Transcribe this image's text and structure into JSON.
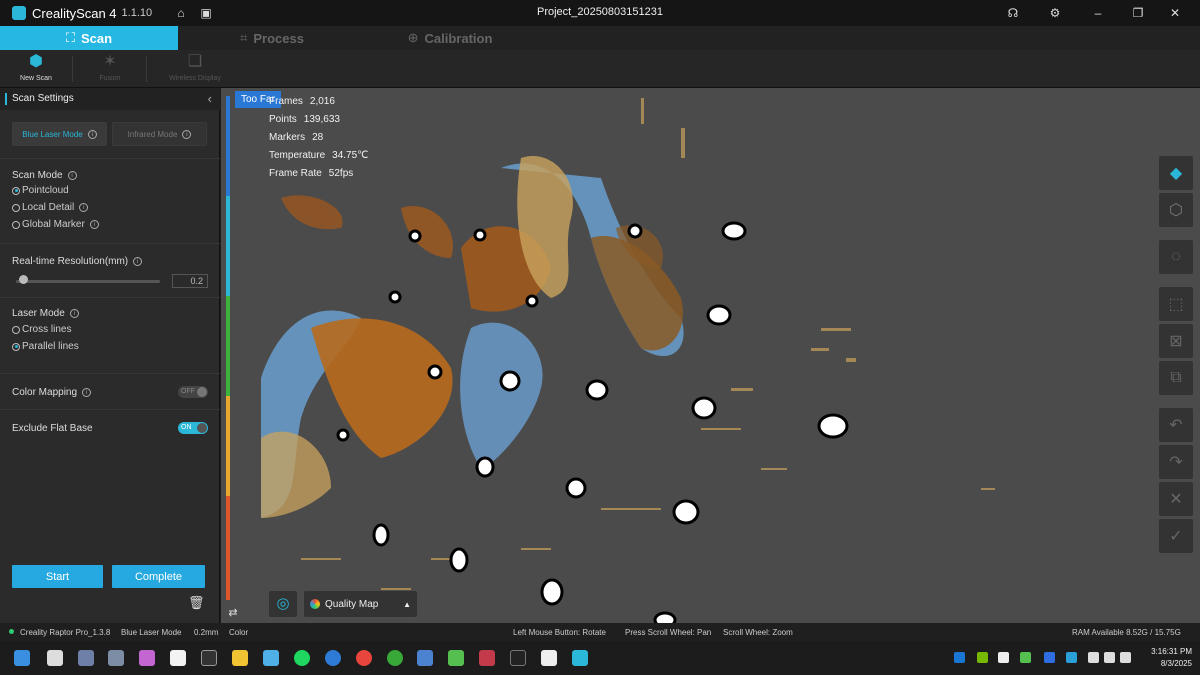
{
  "titlebar": {
    "app_name": "CrealityScan 4",
    "app_version": "1.1.10",
    "project": "Project_20250803151231"
  },
  "tabs": [
    {
      "label": "Scan",
      "active": true
    },
    {
      "label": "Process",
      "active": false
    },
    {
      "label": "Calibration",
      "active": false
    }
  ],
  "toolbar": {
    "new_scan": "New Scan",
    "fusion": "Fusion",
    "wireless_display": "Wireless Display"
  },
  "panel": {
    "title": "Scan Settings",
    "blue_laser_mode": "Blue Laser Mode",
    "infrared_mode": "Infrared Mode",
    "scan_mode_label": "Scan Mode",
    "scan_modes": [
      {
        "label": "Pointcloud",
        "selected": true
      },
      {
        "label": "Local Detail",
        "selected": false
      },
      {
        "label": "Global Marker",
        "selected": false
      }
    ],
    "resolution_label": "Real-time Resolution(mm)",
    "resolution_value": "0.2",
    "laser_mode_label": "Laser Mode",
    "laser_modes": [
      {
        "label": "Cross lines",
        "selected": false
      },
      {
        "label": "Parallel lines",
        "selected": true
      }
    ],
    "color_mapping_label": "Color Mapping",
    "color_mapping_state": "OFF",
    "exclude_flat_base_label": "Exclude Flat Base",
    "exclude_flat_base_state": "ON",
    "start_label": "Start",
    "complete_label": "Complete"
  },
  "viewport": {
    "distance_label": "Too Far",
    "stats": [
      {
        "label": "Frames",
        "value": "2,016"
      },
      {
        "label": "Points",
        "value": "139,633"
      },
      {
        "label": "Markers",
        "value": "28"
      },
      {
        "label": "Temperature",
        "value": "34.75℃"
      },
      {
        "label": "Frame Rate",
        "value": "52fps"
      }
    ],
    "quality_map_label": "Quality Map"
  },
  "statusbar": {
    "device": "Creality Raptor Pro_1.3.8",
    "mode": "Blue Laser Mode",
    "resolution": "0.2mm",
    "color": "Color",
    "hint_left": "Left Mouse Button: Rotate",
    "hint_press": "Press Scroll Wheel: Pan",
    "hint_scroll": "Scroll Wheel: Zoom",
    "ram": "RAM Available 8.52G / 15.75G"
  },
  "taskbar": {
    "time": "3:16:31 PM",
    "date": "8/3/2025"
  },
  "colors": {
    "accent": "#26b7e3",
    "viewport_bg": "#4b4b4b",
    "scan_blue": "#6a9fcf",
    "scan_orange": "#b86a1d",
    "scan_tan": "#c9a35c"
  }
}
